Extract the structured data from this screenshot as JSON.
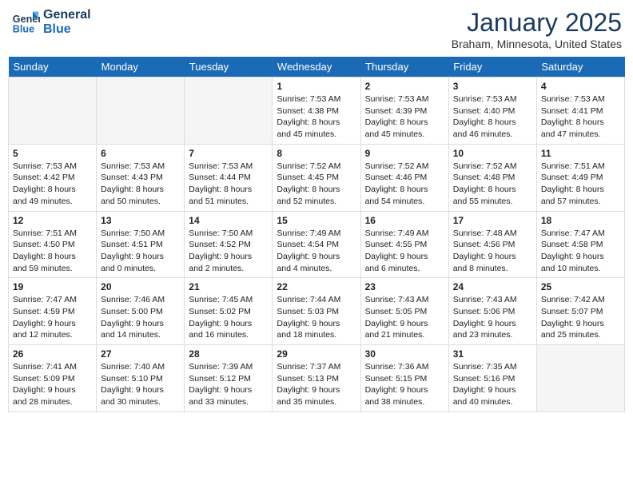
{
  "header": {
    "logo_line1": "General",
    "logo_line2": "Blue",
    "month": "January 2025",
    "location": "Braham, Minnesota, United States"
  },
  "weekdays": [
    "Sunday",
    "Monday",
    "Tuesday",
    "Wednesday",
    "Thursday",
    "Friday",
    "Saturday"
  ],
  "weeks": [
    [
      {
        "day": "",
        "info": ""
      },
      {
        "day": "",
        "info": ""
      },
      {
        "day": "",
        "info": ""
      },
      {
        "day": "1",
        "info": "Sunrise: 7:53 AM\nSunset: 4:38 PM\nDaylight: 8 hours\nand 45 minutes."
      },
      {
        "day": "2",
        "info": "Sunrise: 7:53 AM\nSunset: 4:39 PM\nDaylight: 8 hours\nand 45 minutes."
      },
      {
        "day": "3",
        "info": "Sunrise: 7:53 AM\nSunset: 4:40 PM\nDaylight: 8 hours\nand 46 minutes."
      },
      {
        "day": "4",
        "info": "Sunrise: 7:53 AM\nSunset: 4:41 PM\nDaylight: 8 hours\nand 47 minutes."
      }
    ],
    [
      {
        "day": "5",
        "info": "Sunrise: 7:53 AM\nSunset: 4:42 PM\nDaylight: 8 hours\nand 49 minutes."
      },
      {
        "day": "6",
        "info": "Sunrise: 7:53 AM\nSunset: 4:43 PM\nDaylight: 8 hours\nand 50 minutes."
      },
      {
        "day": "7",
        "info": "Sunrise: 7:53 AM\nSunset: 4:44 PM\nDaylight: 8 hours\nand 51 minutes."
      },
      {
        "day": "8",
        "info": "Sunrise: 7:52 AM\nSunset: 4:45 PM\nDaylight: 8 hours\nand 52 minutes."
      },
      {
        "day": "9",
        "info": "Sunrise: 7:52 AM\nSunset: 4:46 PM\nDaylight: 8 hours\nand 54 minutes."
      },
      {
        "day": "10",
        "info": "Sunrise: 7:52 AM\nSunset: 4:48 PM\nDaylight: 8 hours\nand 55 minutes."
      },
      {
        "day": "11",
        "info": "Sunrise: 7:51 AM\nSunset: 4:49 PM\nDaylight: 8 hours\nand 57 minutes."
      }
    ],
    [
      {
        "day": "12",
        "info": "Sunrise: 7:51 AM\nSunset: 4:50 PM\nDaylight: 8 hours\nand 59 minutes."
      },
      {
        "day": "13",
        "info": "Sunrise: 7:50 AM\nSunset: 4:51 PM\nDaylight: 9 hours\nand 0 minutes."
      },
      {
        "day": "14",
        "info": "Sunrise: 7:50 AM\nSunset: 4:52 PM\nDaylight: 9 hours\nand 2 minutes."
      },
      {
        "day": "15",
        "info": "Sunrise: 7:49 AM\nSunset: 4:54 PM\nDaylight: 9 hours\nand 4 minutes."
      },
      {
        "day": "16",
        "info": "Sunrise: 7:49 AM\nSunset: 4:55 PM\nDaylight: 9 hours\nand 6 minutes."
      },
      {
        "day": "17",
        "info": "Sunrise: 7:48 AM\nSunset: 4:56 PM\nDaylight: 9 hours\nand 8 minutes."
      },
      {
        "day": "18",
        "info": "Sunrise: 7:47 AM\nSunset: 4:58 PM\nDaylight: 9 hours\nand 10 minutes."
      }
    ],
    [
      {
        "day": "19",
        "info": "Sunrise: 7:47 AM\nSunset: 4:59 PM\nDaylight: 9 hours\nand 12 minutes."
      },
      {
        "day": "20",
        "info": "Sunrise: 7:46 AM\nSunset: 5:00 PM\nDaylight: 9 hours\nand 14 minutes."
      },
      {
        "day": "21",
        "info": "Sunrise: 7:45 AM\nSunset: 5:02 PM\nDaylight: 9 hours\nand 16 minutes."
      },
      {
        "day": "22",
        "info": "Sunrise: 7:44 AM\nSunset: 5:03 PM\nDaylight: 9 hours\nand 18 minutes."
      },
      {
        "day": "23",
        "info": "Sunrise: 7:43 AM\nSunset: 5:05 PM\nDaylight: 9 hours\nand 21 minutes."
      },
      {
        "day": "24",
        "info": "Sunrise: 7:43 AM\nSunset: 5:06 PM\nDaylight: 9 hours\nand 23 minutes."
      },
      {
        "day": "25",
        "info": "Sunrise: 7:42 AM\nSunset: 5:07 PM\nDaylight: 9 hours\nand 25 minutes."
      }
    ],
    [
      {
        "day": "26",
        "info": "Sunrise: 7:41 AM\nSunset: 5:09 PM\nDaylight: 9 hours\nand 28 minutes."
      },
      {
        "day": "27",
        "info": "Sunrise: 7:40 AM\nSunset: 5:10 PM\nDaylight: 9 hours\nand 30 minutes."
      },
      {
        "day": "28",
        "info": "Sunrise: 7:39 AM\nSunset: 5:12 PM\nDaylight: 9 hours\nand 33 minutes."
      },
      {
        "day": "29",
        "info": "Sunrise: 7:37 AM\nSunset: 5:13 PM\nDaylight: 9 hours\nand 35 minutes."
      },
      {
        "day": "30",
        "info": "Sunrise: 7:36 AM\nSunset: 5:15 PM\nDaylight: 9 hours\nand 38 minutes."
      },
      {
        "day": "31",
        "info": "Sunrise: 7:35 AM\nSunset: 5:16 PM\nDaylight: 9 hours\nand 40 minutes."
      },
      {
        "day": "",
        "info": ""
      }
    ]
  ]
}
